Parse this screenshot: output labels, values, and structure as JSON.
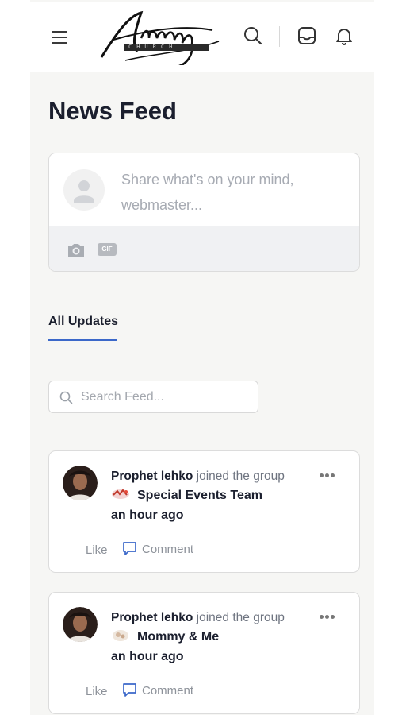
{
  "header": {
    "logo_text": "Amazing",
    "logo_subtext": "CHURCH"
  },
  "page": {
    "title": "News Feed"
  },
  "composer": {
    "placeholder": "Share what's on your mind, webmaster..."
  },
  "tabs": [
    {
      "label": "All Updates",
      "active": true
    }
  ],
  "search": {
    "placeholder": "Search Feed..."
  },
  "feed": [
    {
      "author": "Prophet lehko",
      "action": "joined the group",
      "group": "Special Events Team",
      "time": "an hour ago",
      "like_label": "Like",
      "comment_label": "Comment"
    },
    {
      "author": "Prophet lehko",
      "action": "joined the group",
      "group": "Mommy & Me",
      "time": "an hour ago",
      "like_label": "Like",
      "comment_label": "Comment"
    }
  ],
  "colors": {
    "accent": "#3b68c9",
    "background": "#f6f6f4",
    "title": "#1b1f2e",
    "muted": "#8d929a"
  },
  "icons": [
    "menu-icon",
    "search-icon",
    "inbox-icon",
    "bell-icon",
    "camera-icon",
    "gif-icon",
    "more-icon",
    "comment-icon",
    "avatar-placeholder-icon"
  ]
}
